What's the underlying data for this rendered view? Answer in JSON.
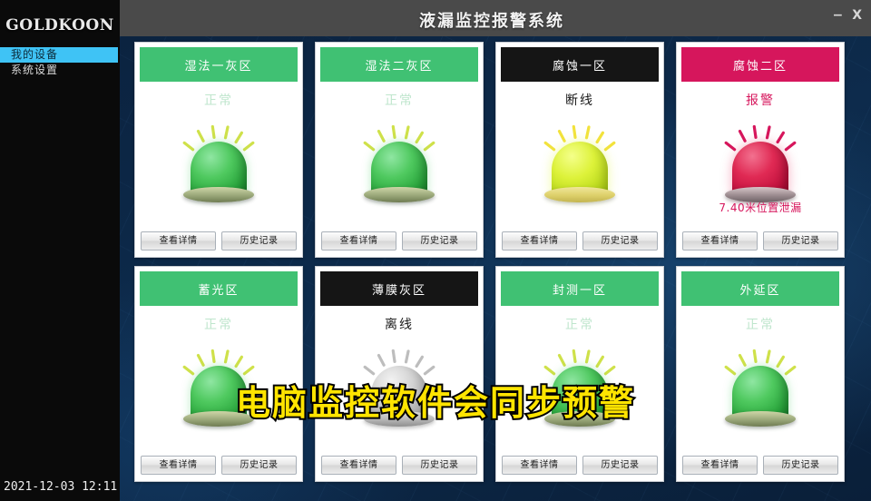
{
  "window": {
    "title": "液漏监控报警系统",
    "minimize_label": "−",
    "close_label": "X"
  },
  "sidebar": {
    "brand": "GOLDKOON",
    "items": [
      {
        "label": "我的设备",
        "active": true
      },
      {
        "label": "系统设置",
        "active": false
      }
    ],
    "clock": "2021-12-03  12:11"
  },
  "buttons": {
    "details_label": "查看详情",
    "history_label": "历史记录"
  },
  "colors": {
    "normal": "#40c173",
    "alarm": "#d6165c",
    "offline": "#151515",
    "sidebar_active": "#3fc3f5",
    "board_bg": "#0d2b4c",
    "caption": "#ffe400"
  },
  "cards": [
    {
      "name": "湿法一灰区",
      "status": "正常",
      "state": "normal",
      "lamp": "green",
      "detail": ""
    },
    {
      "name": "湿法二灰区",
      "status": "正常",
      "state": "normal",
      "lamp": "green",
      "detail": ""
    },
    {
      "name": "腐蚀一区",
      "status": "断线",
      "state": "broken",
      "lamp": "yellow",
      "detail": ""
    },
    {
      "name": "腐蚀二区",
      "status": "报警",
      "state": "alarm",
      "lamp": "red",
      "detail": "7.40米位置泄漏"
    },
    {
      "name": "蓄光区",
      "status": "正常",
      "state": "normal",
      "lamp": "green",
      "detail": ""
    },
    {
      "name": "薄膜灰区",
      "status": "离线",
      "state": "offline",
      "lamp": "gray",
      "detail": ""
    },
    {
      "name": "封测一区",
      "status": "正常",
      "state": "normal",
      "lamp": "green",
      "detail": ""
    },
    {
      "name": "外延区",
      "status": "正常",
      "state": "normal",
      "lamp": "green",
      "detail": ""
    }
  ],
  "overlay": {
    "caption": "电脑监控软件会同步预警"
  }
}
